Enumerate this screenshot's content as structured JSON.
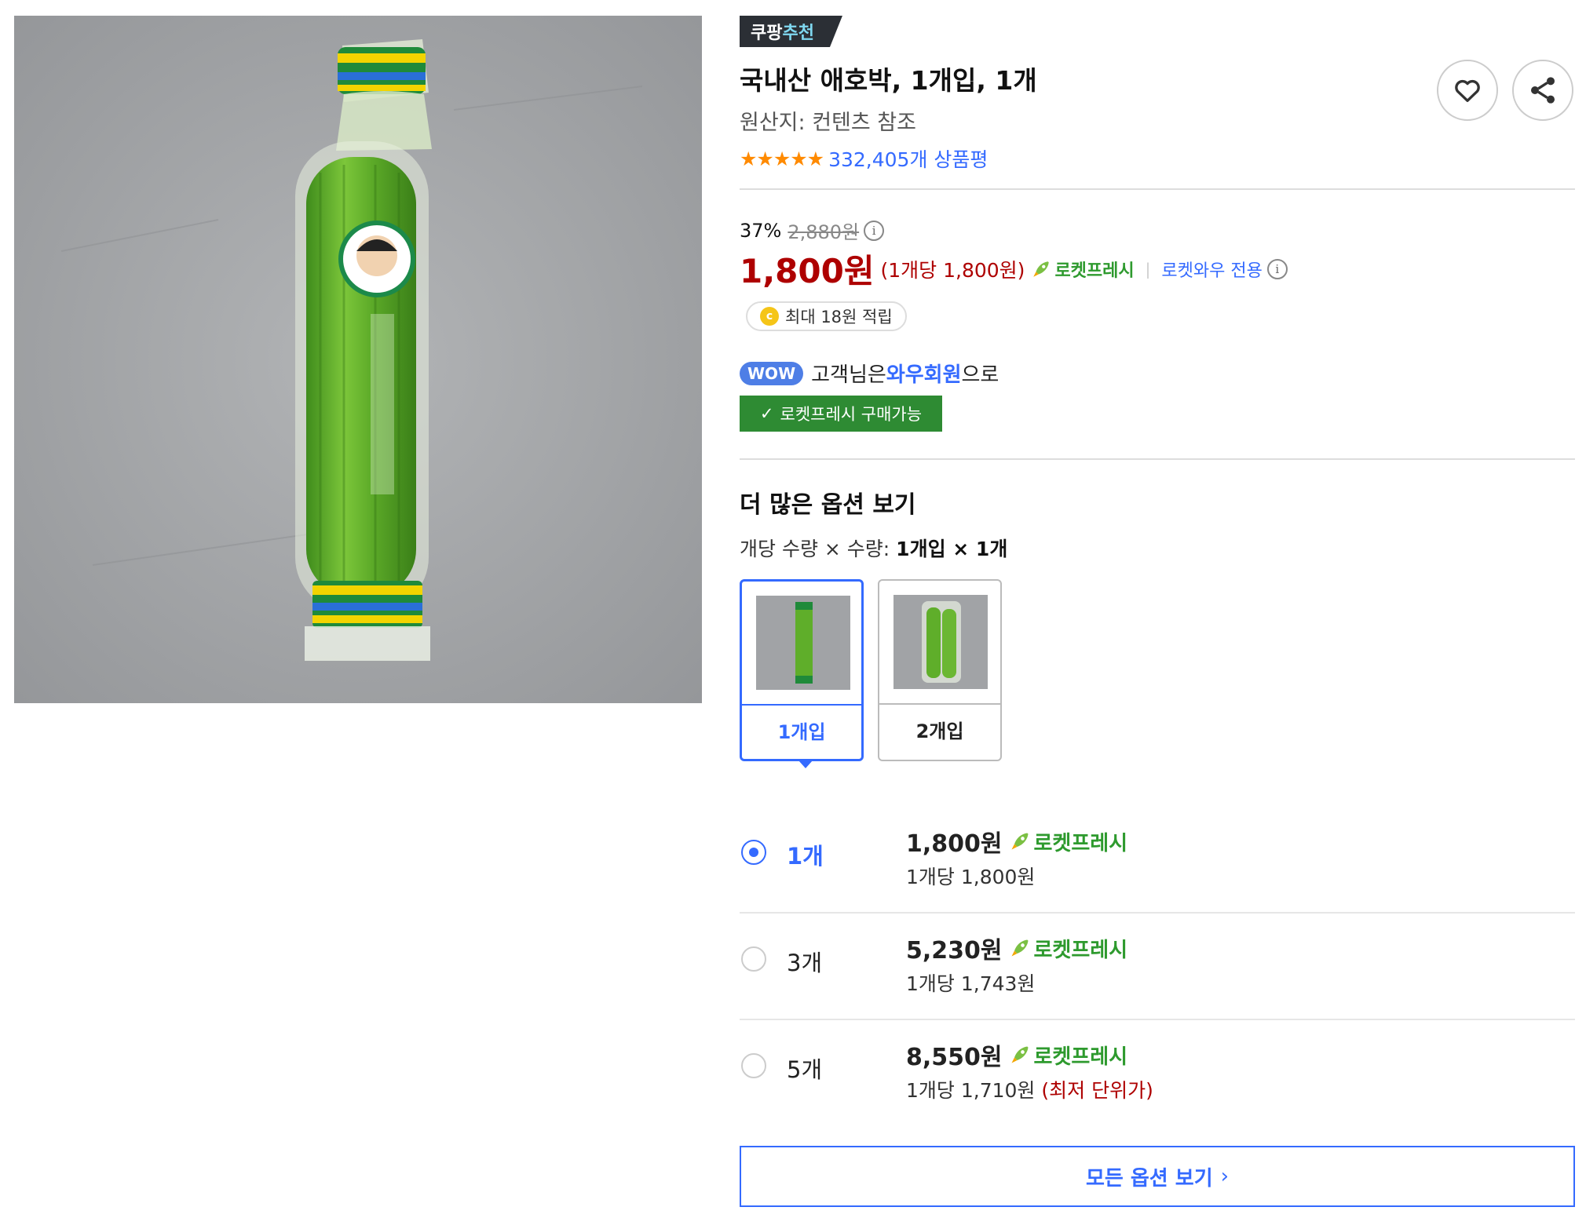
{
  "badge": {
    "part1": "쿠팡",
    "part2": "추천"
  },
  "product": {
    "title": "국내산 애호박, 1개입, 1개",
    "origin": "원산지: 컨텐츠 참조",
    "stars": "★★★★★",
    "review_count": "332,405개 상품평"
  },
  "actions": {
    "favorite_icon": "heart-icon",
    "share_icon": "share-icon"
  },
  "pricing": {
    "discount": "37%",
    "original_price": "2,880원",
    "info_mark": "i",
    "sale_price": "1,800원",
    "unit_price": "(1개당 1,800원)",
    "rocket_fresh": "로켓프레시",
    "separator": "|",
    "wow_only": "로켓와우 전용",
    "cashback_coin": "c",
    "cashback": "최대 18원 적립"
  },
  "wow": {
    "pill": "WOW",
    "text_before": "고객님은 ",
    "highlight": "와우회원",
    "text_after": "으로",
    "fresh_available": "로켓프레시 구매가능",
    "check": "✓"
  },
  "options": {
    "section_title": "더 많은 옵션 보기",
    "qty_label": "개당 수량 × 수량: ",
    "qty_value": "1개입 × 1개",
    "cards": [
      {
        "label": "1개입",
        "selected": true
      },
      {
        "label": "2개입",
        "selected": false
      }
    ],
    "rows": [
      {
        "count": "1개",
        "price": "1,800원",
        "per_unit": "1개당 1,800원",
        "badge": "로켓프레시",
        "lowest": "",
        "selected": true
      },
      {
        "count": "3개",
        "price": "5,230원",
        "per_unit": "1개당 1,743원",
        "badge": "로켓프레시",
        "lowest": "",
        "selected": false
      },
      {
        "count": "5개",
        "price": "8,550원",
        "per_unit": "1개당 1,710원",
        "badge": "로켓프레시",
        "lowest": " (최저 단위가)",
        "selected": false
      }
    ],
    "view_all": "모든 옵션 보기",
    "view_all_chevron": "›"
  },
  "colors": {
    "accent_blue": "#346aff",
    "price_red": "#ae0000",
    "rocket_green": "#2e9a2e",
    "star_orange": "#ff8a00"
  }
}
